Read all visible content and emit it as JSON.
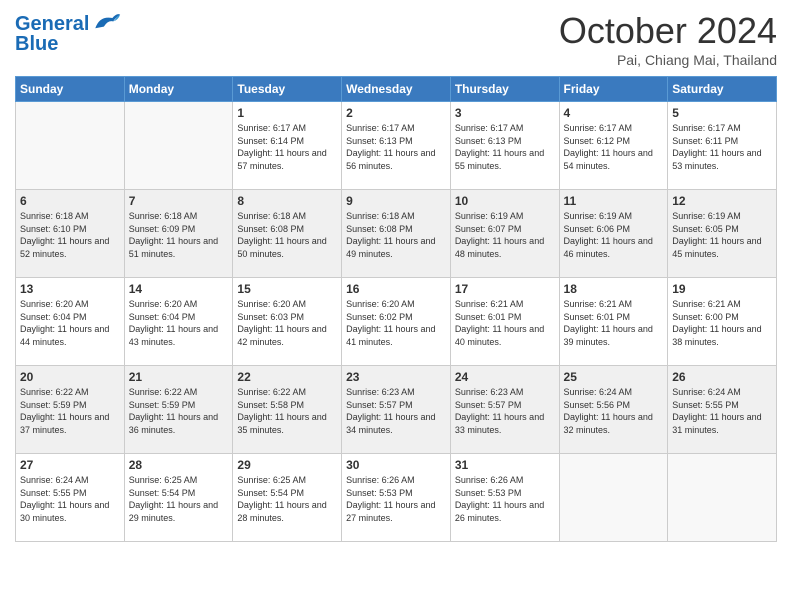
{
  "header": {
    "logo_line1": "General",
    "logo_line2": "Blue",
    "month_title": "October 2024",
    "location": "Pai, Chiang Mai, Thailand"
  },
  "weekdays": [
    "Sunday",
    "Monday",
    "Tuesday",
    "Wednesday",
    "Thursday",
    "Friday",
    "Saturday"
  ],
  "weeks": [
    [
      {
        "day": "",
        "info": ""
      },
      {
        "day": "",
        "info": ""
      },
      {
        "day": "1",
        "info": "Sunrise: 6:17 AM\nSunset: 6:14 PM\nDaylight: 11 hours and 57 minutes."
      },
      {
        "day": "2",
        "info": "Sunrise: 6:17 AM\nSunset: 6:13 PM\nDaylight: 11 hours and 56 minutes."
      },
      {
        "day": "3",
        "info": "Sunrise: 6:17 AM\nSunset: 6:13 PM\nDaylight: 11 hours and 55 minutes."
      },
      {
        "day": "4",
        "info": "Sunrise: 6:17 AM\nSunset: 6:12 PM\nDaylight: 11 hours and 54 minutes."
      },
      {
        "day": "5",
        "info": "Sunrise: 6:17 AM\nSunset: 6:11 PM\nDaylight: 11 hours and 53 minutes."
      }
    ],
    [
      {
        "day": "6",
        "info": "Sunrise: 6:18 AM\nSunset: 6:10 PM\nDaylight: 11 hours and 52 minutes."
      },
      {
        "day": "7",
        "info": "Sunrise: 6:18 AM\nSunset: 6:09 PM\nDaylight: 11 hours and 51 minutes."
      },
      {
        "day": "8",
        "info": "Sunrise: 6:18 AM\nSunset: 6:08 PM\nDaylight: 11 hours and 50 minutes."
      },
      {
        "day": "9",
        "info": "Sunrise: 6:18 AM\nSunset: 6:08 PM\nDaylight: 11 hours and 49 minutes."
      },
      {
        "day": "10",
        "info": "Sunrise: 6:19 AM\nSunset: 6:07 PM\nDaylight: 11 hours and 48 minutes."
      },
      {
        "day": "11",
        "info": "Sunrise: 6:19 AM\nSunset: 6:06 PM\nDaylight: 11 hours and 46 minutes."
      },
      {
        "day": "12",
        "info": "Sunrise: 6:19 AM\nSunset: 6:05 PM\nDaylight: 11 hours and 45 minutes."
      }
    ],
    [
      {
        "day": "13",
        "info": "Sunrise: 6:20 AM\nSunset: 6:04 PM\nDaylight: 11 hours and 44 minutes."
      },
      {
        "day": "14",
        "info": "Sunrise: 6:20 AM\nSunset: 6:04 PM\nDaylight: 11 hours and 43 minutes."
      },
      {
        "day": "15",
        "info": "Sunrise: 6:20 AM\nSunset: 6:03 PM\nDaylight: 11 hours and 42 minutes."
      },
      {
        "day": "16",
        "info": "Sunrise: 6:20 AM\nSunset: 6:02 PM\nDaylight: 11 hours and 41 minutes."
      },
      {
        "day": "17",
        "info": "Sunrise: 6:21 AM\nSunset: 6:01 PM\nDaylight: 11 hours and 40 minutes."
      },
      {
        "day": "18",
        "info": "Sunrise: 6:21 AM\nSunset: 6:01 PM\nDaylight: 11 hours and 39 minutes."
      },
      {
        "day": "19",
        "info": "Sunrise: 6:21 AM\nSunset: 6:00 PM\nDaylight: 11 hours and 38 minutes."
      }
    ],
    [
      {
        "day": "20",
        "info": "Sunrise: 6:22 AM\nSunset: 5:59 PM\nDaylight: 11 hours and 37 minutes."
      },
      {
        "day": "21",
        "info": "Sunrise: 6:22 AM\nSunset: 5:59 PM\nDaylight: 11 hours and 36 minutes."
      },
      {
        "day": "22",
        "info": "Sunrise: 6:22 AM\nSunset: 5:58 PM\nDaylight: 11 hours and 35 minutes."
      },
      {
        "day": "23",
        "info": "Sunrise: 6:23 AM\nSunset: 5:57 PM\nDaylight: 11 hours and 34 minutes."
      },
      {
        "day": "24",
        "info": "Sunrise: 6:23 AM\nSunset: 5:57 PM\nDaylight: 11 hours and 33 minutes."
      },
      {
        "day": "25",
        "info": "Sunrise: 6:24 AM\nSunset: 5:56 PM\nDaylight: 11 hours and 32 minutes."
      },
      {
        "day": "26",
        "info": "Sunrise: 6:24 AM\nSunset: 5:55 PM\nDaylight: 11 hours and 31 minutes."
      }
    ],
    [
      {
        "day": "27",
        "info": "Sunrise: 6:24 AM\nSunset: 5:55 PM\nDaylight: 11 hours and 30 minutes."
      },
      {
        "day": "28",
        "info": "Sunrise: 6:25 AM\nSunset: 5:54 PM\nDaylight: 11 hours and 29 minutes."
      },
      {
        "day": "29",
        "info": "Sunrise: 6:25 AM\nSunset: 5:54 PM\nDaylight: 11 hours and 28 minutes."
      },
      {
        "day": "30",
        "info": "Sunrise: 6:26 AM\nSunset: 5:53 PM\nDaylight: 11 hours and 27 minutes."
      },
      {
        "day": "31",
        "info": "Sunrise: 6:26 AM\nSunset: 5:53 PM\nDaylight: 11 hours and 26 minutes."
      },
      {
        "day": "",
        "info": ""
      },
      {
        "day": "",
        "info": ""
      }
    ]
  ]
}
